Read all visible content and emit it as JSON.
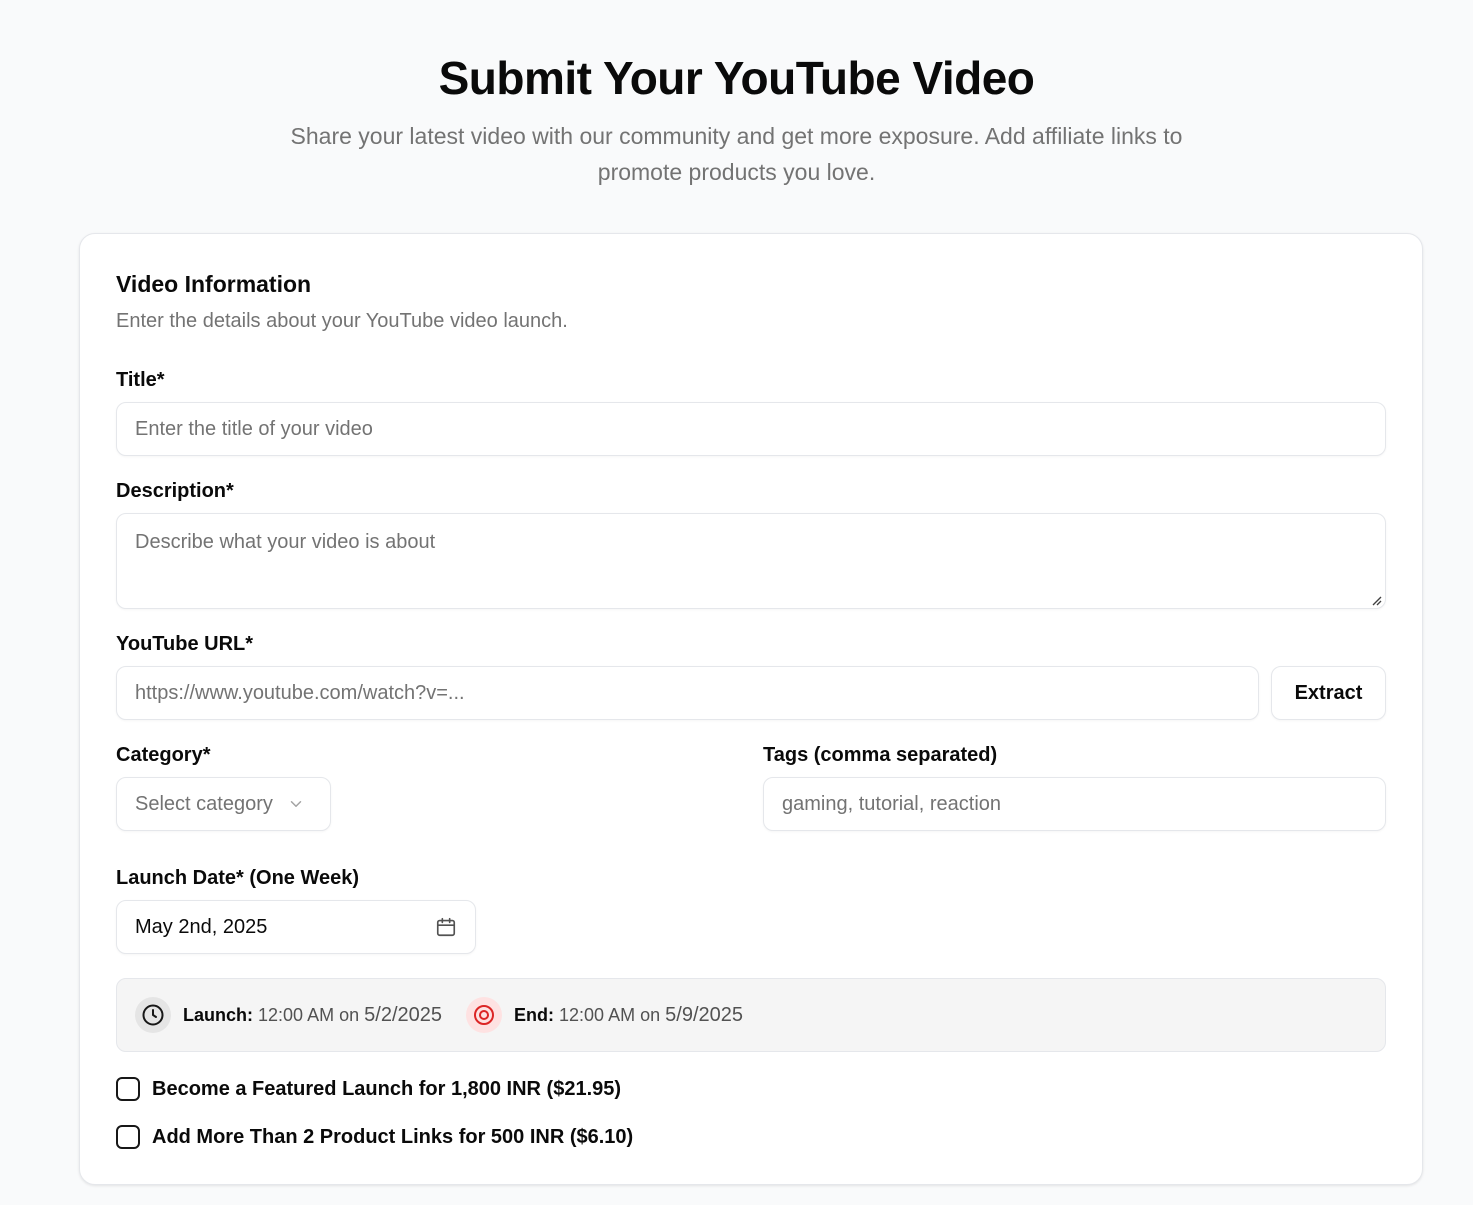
{
  "header": {
    "title": "Submit Your YouTube Video",
    "subtitle": "Share your latest video with our community and get more exposure. Add affiliate links to promote products you love."
  },
  "card": {
    "title": "Video Information",
    "description": "Enter the details about your YouTube video launch."
  },
  "fields": {
    "title": {
      "label": "Title*",
      "placeholder": "Enter the title of your video",
      "value": ""
    },
    "description": {
      "label": "Description*",
      "placeholder": "Describe what your video is about",
      "value": ""
    },
    "youtube_url": {
      "label": "YouTube URL*",
      "placeholder": "https://www.youtube.com/watch?v=...",
      "value": "",
      "button": "Extract"
    },
    "category": {
      "label": "Category*",
      "placeholder": "Select category"
    },
    "tags": {
      "label": "Tags (comma separated)",
      "placeholder": "gaming, tutorial, reaction",
      "value": ""
    },
    "launch_date": {
      "label": "Launch Date* (One Week)",
      "value": "May 2nd, 2025"
    }
  },
  "timeline": {
    "launch_label": "Launch:",
    "launch_time": "12:00 AM",
    "on_word": "on",
    "launch_date": "5/2/2025",
    "end_label": "End:",
    "end_time": "12:00 AM",
    "end_date": "5/9/2025"
  },
  "options": [
    {
      "label": "Become a Featured Launch for 1,800 INR ($21.95)",
      "checked": false
    },
    {
      "label": "Add More Than 2 Product Links for 500 INR ($6.10)",
      "checked": false
    }
  ],
  "colors": {
    "accent_danger": "#dc2626",
    "text_muted": "#737373",
    "border": "#e5e7eb"
  },
  "icons": [
    "chevron-down-icon",
    "calendar-icon",
    "clock-icon",
    "target-icon"
  ]
}
